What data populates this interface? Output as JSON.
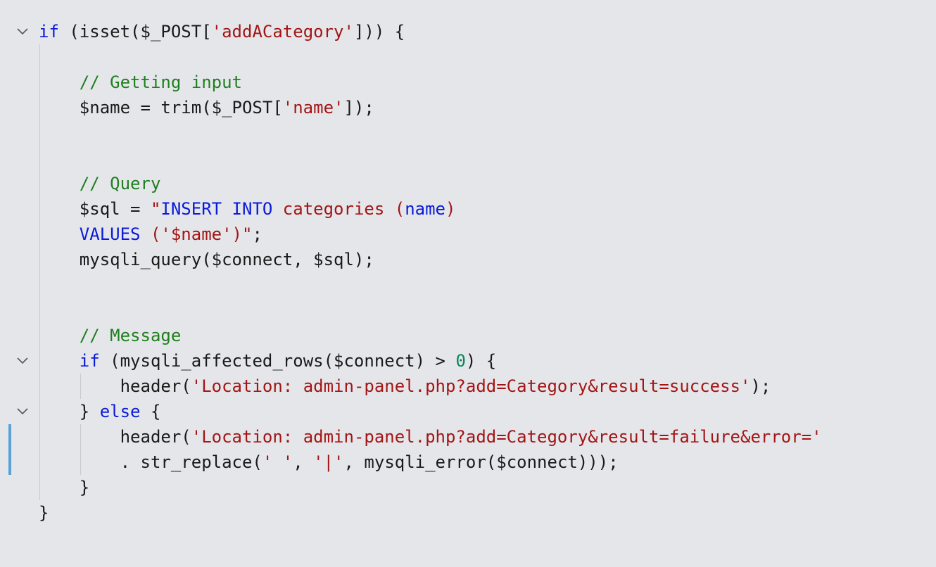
{
  "editor": {
    "language": "PHP",
    "colors": {
      "background": "#e5e6ea",
      "keyword": "#0a1ad8",
      "string": "#a31515",
      "comment": "#1f7f1f",
      "number": "#098658",
      "plain": "#1a1a1a",
      "change_marker": "#5aa2d6",
      "indent_guide": "#c9cacf"
    },
    "lines": [
      {
        "tokens": [
          [
            "kw",
            "if"
          ],
          [
            "pl",
            " (isset($_POST["
          ],
          [
            "str",
            "'addACategory'"
          ],
          [
            "pl",
            "])) {"
          ]
        ],
        "fold": true
      },
      {
        "tokens": []
      },
      {
        "tokens": [
          [
            "cmt",
            "    // Getting input"
          ]
        ]
      },
      {
        "tokens": [
          [
            "pl",
            "    $name = trim($_POST["
          ],
          [
            "str",
            "'name'"
          ],
          [
            "pl",
            "]);"
          ]
        ]
      },
      {
        "tokens": []
      },
      {
        "tokens": []
      },
      {
        "tokens": [
          [
            "cmt",
            "    // Query"
          ]
        ]
      },
      {
        "tokens": [
          [
            "pl",
            "    $sql = "
          ],
          [
            "str",
            "\""
          ],
          [
            "kw",
            "INSERT INTO"
          ],
          [
            "str",
            " categories ("
          ],
          [
            "kw",
            "name"
          ],
          [
            "str",
            ")"
          ]
        ]
      },
      {
        "tokens": [
          [
            "kw",
            "    VALUES"
          ],
          [
            "str",
            " ('$name')\""
          ],
          [
            "pl",
            ";"
          ]
        ]
      },
      {
        "tokens": [
          [
            "pl",
            "    mysqli_query($connect, $sql);"
          ]
        ]
      },
      {
        "tokens": []
      },
      {
        "tokens": []
      },
      {
        "tokens": [
          [
            "cmt",
            "    // Message"
          ]
        ]
      },
      {
        "tokens": [
          [
            "kw",
            "    if"
          ],
          [
            "pl",
            " (mysqli_affected_rows($connect) > "
          ],
          [
            "num",
            "0"
          ],
          [
            "pl",
            ") {"
          ]
        ],
        "fold": true
      },
      {
        "tokens": [
          [
            "pl",
            "        header("
          ],
          [
            "str",
            "'Location: admin-panel.php?add=Category&result=success'"
          ],
          [
            "pl",
            ");"
          ]
        ]
      },
      {
        "tokens": [
          [
            "pl",
            "    } "
          ],
          [
            "kw",
            "else"
          ],
          [
            "pl",
            " {"
          ]
        ],
        "fold": true
      },
      {
        "tokens": [
          [
            "pl",
            "        header("
          ],
          [
            "str",
            "'Location: admin-panel.php?add=Category&result=failure&error='"
          ]
        ],
        "changed": true
      },
      {
        "tokens": [
          [
            "pl",
            "        . str_replace("
          ],
          [
            "str",
            "' '"
          ],
          [
            "pl",
            ", "
          ],
          [
            "str",
            "'|'"
          ],
          [
            "pl",
            ", mysqli_error($connect)));"
          ]
        ],
        "changed": true
      },
      {
        "tokens": [
          [
            "pl",
            "    }"
          ]
        ]
      },
      {
        "tokens": [
          [
            "pl",
            "}"
          ]
        ]
      }
    ]
  }
}
